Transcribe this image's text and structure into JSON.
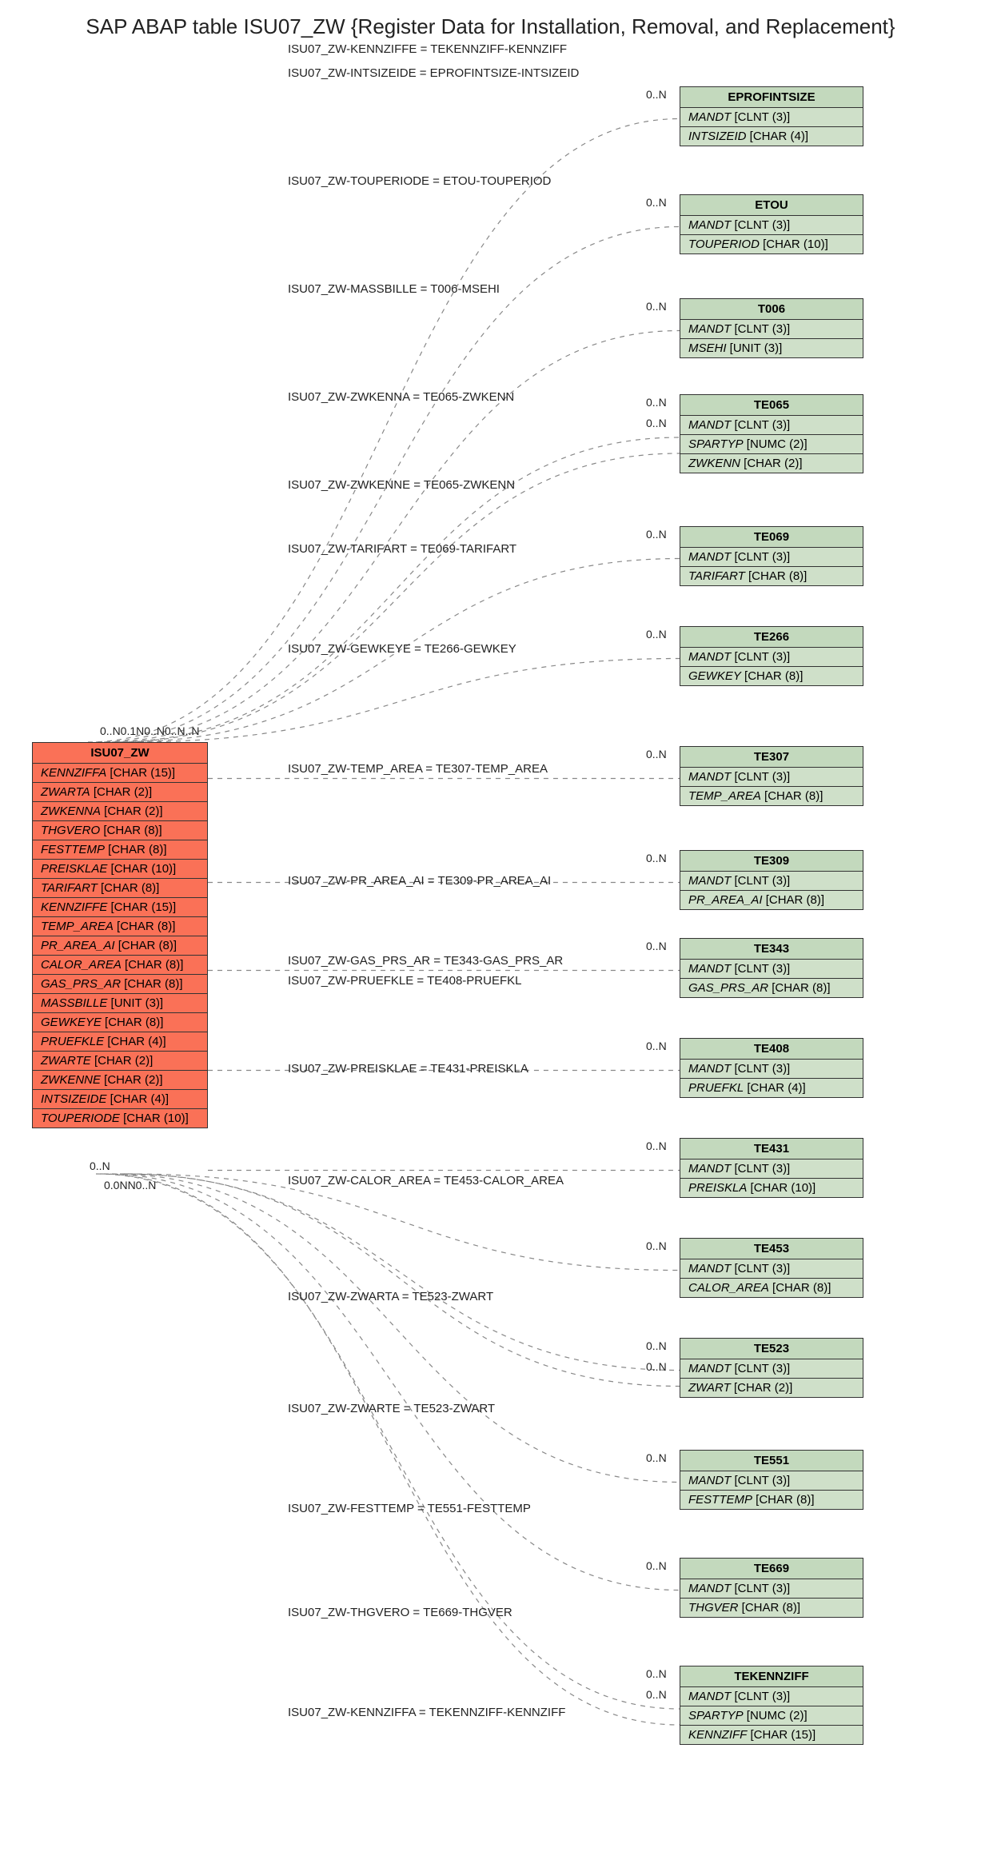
{
  "title": "SAP ABAP table ISU07_ZW {Register Data for Installation, Removal, and Replacement}",
  "main": {
    "name": "ISU07_ZW",
    "fields": [
      {
        "f": "KENNZIFFA",
        "t": "[CHAR (15)]"
      },
      {
        "f": "ZWARTA",
        "t": "[CHAR (2)]"
      },
      {
        "f": "ZWKENNA",
        "t": "[CHAR (2)]"
      },
      {
        "f": "THGVERO",
        "t": "[CHAR (8)]"
      },
      {
        "f": "FESTTEMP",
        "t": "[CHAR (8)]"
      },
      {
        "f": "PREISKLAE",
        "t": "[CHAR (10)]"
      },
      {
        "f": "TARIFART",
        "t": "[CHAR (8)]"
      },
      {
        "f": "KENNZIFFE",
        "t": "[CHAR (15)]"
      },
      {
        "f": "TEMP_AREA",
        "t": "[CHAR (8)]"
      },
      {
        "f": "PR_AREA_AI",
        "t": "[CHAR (8)]"
      },
      {
        "f": "CALOR_AREA",
        "t": "[CHAR (8)]"
      },
      {
        "f": "GAS_PRS_AR",
        "t": "[CHAR (8)]"
      },
      {
        "f": "MASSBILLE",
        "t": "[UNIT (3)]"
      },
      {
        "f": "GEWKEYE",
        "t": "[CHAR (8)]"
      },
      {
        "f": "PRUEFKLE",
        "t": "[CHAR (4)]"
      },
      {
        "f": "ZWARTE",
        "t": "[CHAR (2)]"
      },
      {
        "f": "ZWKENNE",
        "t": "[CHAR (2)]"
      },
      {
        "f": "INTSIZEIDE",
        "t": "[CHAR (4)]"
      },
      {
        "f": "TOUPERIODE",
        "t": "[CHAR (10)]"
      }
    ]
  },
  "targets": [
    {
      "name": "EPROFINTSIZE",
      "rows": [
        {
          "f": "MANDT",
          "t": "[CLNT (3)]"
        },
        {
          "f": "INTSIZEID",
          "t": "[CHAR (4)]"
        }
      ],
      "edge": "ISU07_ZW-INTSIZEIDE = EPROFINTSIZE-INTSIZEID"
    },
    {
      "name": "ETOU",
      "rows": [
        {
          "f": "MANDT",
          "t": "[CLNT (3)]"
        },
        {
          "f": "TOUPERIOD",
          "t": "[CHAR (10)]"
        }
      ],
      "edge": "ISU07_ZW-TOUPERIODE = ETOU-TOUPERIOD"
    },
    {
      "name": "T006",
      "rows": [
        {
          "f": "MANDT",
          "t": "[CLNT (3)]"
        },
        {
          "f": "MSEHI",
          "t": "[UNIT (3)]"
        }
      ],
      "edge": "ISU07_ZW-MASSBILLE = T006-MSEHI"
    },
    {
      "name": "TE065",
      "rows": [
        {
          "f": "MANDT",
          "t": "[CLNT (3)]"
        },
        {
          "f": "SPARTYP",
          "t": "[NUMC (2)]"
        },
        {
          "f": "ZWKENN",
          "t": "[CHAR (2)]"
        }
      ],
      "edge": "ISU07_ZW-ZWKENNA = TE065-ZWKENN",
      "edge2": "ISU07_ZW-ZWKENNE = TE065-ZWKENN"
    },
    {
      "name": "TE069",
      "rows": [
        {
          "f": "MANDT",
          "t": "[CLNT (3)]"
        },
        {
          "f": "TARIFART",
          "t": "[CHAR (8)]"
        }
      ],
      "edge": "ISU07_ZW-TARIFART = TE069-TARIFART"
    },
    {
      "name": "TE266",
      "rows": [
        {
          "f": "MANDT",
          "t": "[CLNT (3)]"
        },
        {
          "f": "GEWKEY",
          "t": "[CHAR (8)]"
        }
      ],
      "edge": "ISU07_ZW-GEWKEYE = TE266-GEWKEY"
    },
    {
      "name": "TE307",
      "rows": [
        {
          "f": "MANDT",
          "t": "[CLNT (3)]"
        },
        {
          "f": "TEMP_AREA",
          "t": "[CHAR (8)]"
        }
      ],
      "edge": "ISU07_ZW-TEMP_AREA = TE307-TEMP_AREA"
    },
    {
      "name": "TE309",
      "rows": [
        {
          "f": "MANDT",
          "t": "[CLNT (3)]"
        },
        {
          "f": "PR_AREA_AI",
          "t": "[CHAR (8)]"
        }
      ],
      "edge": "ISU07_ZW-PR_AREA_AI = TE309-PR_AREA_AI"
    },
    {
      "name": "TE343",
      "rows": [
        {
          "f": "MANDT",
          "t": "[CLNT (3)]"
        },
        {
          "f": "GAS_PRS_AR",
          "t": "[CHAR (8)]"
        }
      ],
      "edge": "ISU07_ZW-GAS_PRS_AR = TE343-GAS_PRS_AR"
    },
    {
      "name": "TE408",
      "rows": [
        {
          "f": "MANDT",
          "t": "[CLNT (3)]"
        },
        {
          "f": "PRUEFKL",
          "t": "[CHAR (4)]"
        }
      ],
      "edge": "ISU07_ZW-PRUEFKLE = TE408-PRUEFKL"
    },
    {
      "name": "TE431",
      "rows": [
        {
          "f": "MANDT",
          "t": "[CLNT (3)]"
        },
        {
          "f": "PREISKLA",
          "t": "[CHAR (10)]"
        }
      ],
      "edge": "ISU07_ZW-PREISKLAE = TE431-PREISKLA"
    },
    {
      "name": "TE453",
      "rows": [
        {
          "f": "MANDT",
          "t": "[CLNT (3)]"
        },
        {
          "f": "CALOR_AREA",
          "t": "[CHAR (8)]"
        }
      ],
      "edge": "ISU07_ZW-CALOR_AREA = TE453-CALOR_AREA"
    },
    {
      "name": "TE523",
      "rows": [
        {
          "f": "MANDT",
          "t": "[CLNT (3)]"
        },
        {
          "f": "ZWART",
          "t": "[CHAR (2)]"
        }
      ],
      "edge": "ISU07_ZW-ZWARTA = TE523-ZWART",
      "edge2": "ISU07_ZW-ZWARTE = TE523-ZWART"
    },
    {
      "name": "TE551",
      "rows": [
        {
          "f": "MANDT",
          "t": "[CLNT (3)]"
        },
        {
          "f": "FESTTEMP",
          "t": "[CHAR (8)]"
        }
      ],
      "edge": "ISU07_ZW-FESTTEMP = TE551-FESTTEMP"
    },
    {
      "name": "TE669",
      "rows": [
        {
          "f": "MANDT",
          "t": "[CLNT (3)]"
        },
        {
          "f": "THGVER",
          "t": "[CHAR (8)]"
        }
      ],
      "edge": "ISU07_ZW-THGVERO = TE669-THGVER"
    },
    {
      "name": "TEKENNZIFF",
      "rows": [
        {
          "f": "MANDT",
          "t": "[CLNT (3)]"
        },
        {
          "f": "SPARTYP",
          "t": "[NUMC (2)]"
        },
        {
          "f": "KENNZIFF",
          "t": "[CHAR (15)]"
        }
      ],
      "edge": "ISU07_ZW-KENNZIFFA = TEKENNZIFF-KENNZIFF",
      "edge2": "ISU07_ZW-KENNZIFFE = TEKENNZIFF-KENNZIFF"
    }
  ],
  "layout": {
    "mainTop": 875,
    "mainLeft": 40,
    "mainW": 220,
    "tgtLeft": 850,
    "tgtW": 230,
    "tgtTops": [
      55,
      190,
      320,
      440,
      605,
      730,
      880,
      1010,
      1120,
      1245,
      1370,
      1495,
      1620,
      1760,
      1895,
      2030
    ],
    "edgeLabelX": 360,
    "edgeLabelY": [
      30,
      165,
      300,
      435,
      545,
      625,
      750,
      900,
      1040,
      1140,
      1165,
      1275,
      1415,
      1560,
      1700,
      1825,
      1955,
      2080
    ],
    "mainTopCard": "0..N0.1N0..N0..N..N",
    "mainBotCard": "0.0NN0..N",
    "mainBotCard2": "0..N"
  },
  "card": "0..N"
}
